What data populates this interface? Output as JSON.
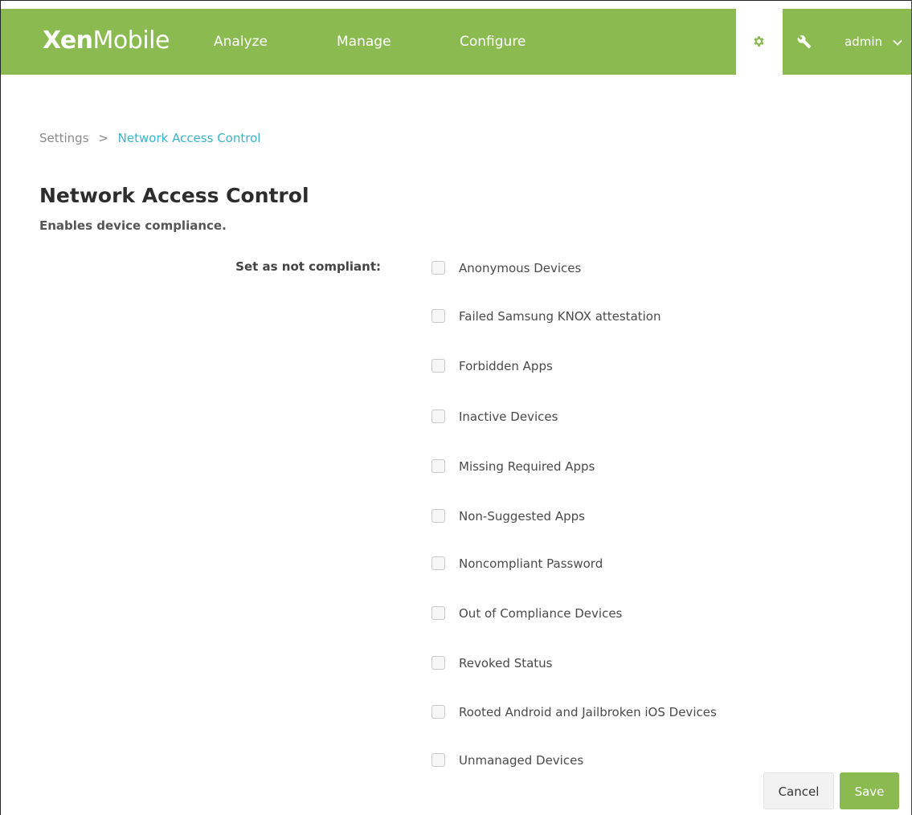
{
  "header": {
    "logo_bold": "Xen",
    "logo_light": "Mobile",
    "nav": {
      "analyze": "Analyze",
      "manage": "Manage",
      "configure": "Configure"
    },
    "settings_icon": "gear-icon",
    "tools_icon": "wrench-icon",
    "user_menu": {
      "label": "admin",
      "icon": "chevron-down-icon"
    },
    "colors": {
      "bar": "#8bbb50",
      "active_tab": "#ffffff"
    }
  },
  "breadcrumb": {
    "parent": "Settings",
    "separator": ">",
    "current": "Network Access Control"
  },
  "page": {
    "title": "Network Access Control",
    "subtitle": "Enables device compliance."
  },
  "compliance": {
    "label": "Set as not compliant:",
    "options": [
      {
        "label": "Anonymous Devices",
        "checked": false
      },
      {
        "label": "Failed Samsung KNOX attestation",
        "checked": false
      },
      {
        "label": "Forbidden Apps",
        "checked": false
      },
      {
        "label": "Inactive Devices",
        "checked": false
      },
      {
        "label": "Missing Required Apps",
        "checked": false
      },
      {
        "label": "Non-Suggested Apps",
        "checked": false
      },
      {
        "label": "Noncompliant Password",
        "checked": false
      },
      {
        "label": "Out of Compliance Devices",
        "checked": false
      },
      {
        "label": "Revoked Status",
        "checked": false
      },
      {
        "label": "Rooted Android and Jailbroken iOS Devices",
        "checked": false
      },
      {
        "label": "Unmanaged Devices",
        "checked": false
      }
    ]
  },
  "footer": {
    "cancel_label": "Cancel",
    "save_label": "Save",
    "accent": "#8bbb50"
  }
}
